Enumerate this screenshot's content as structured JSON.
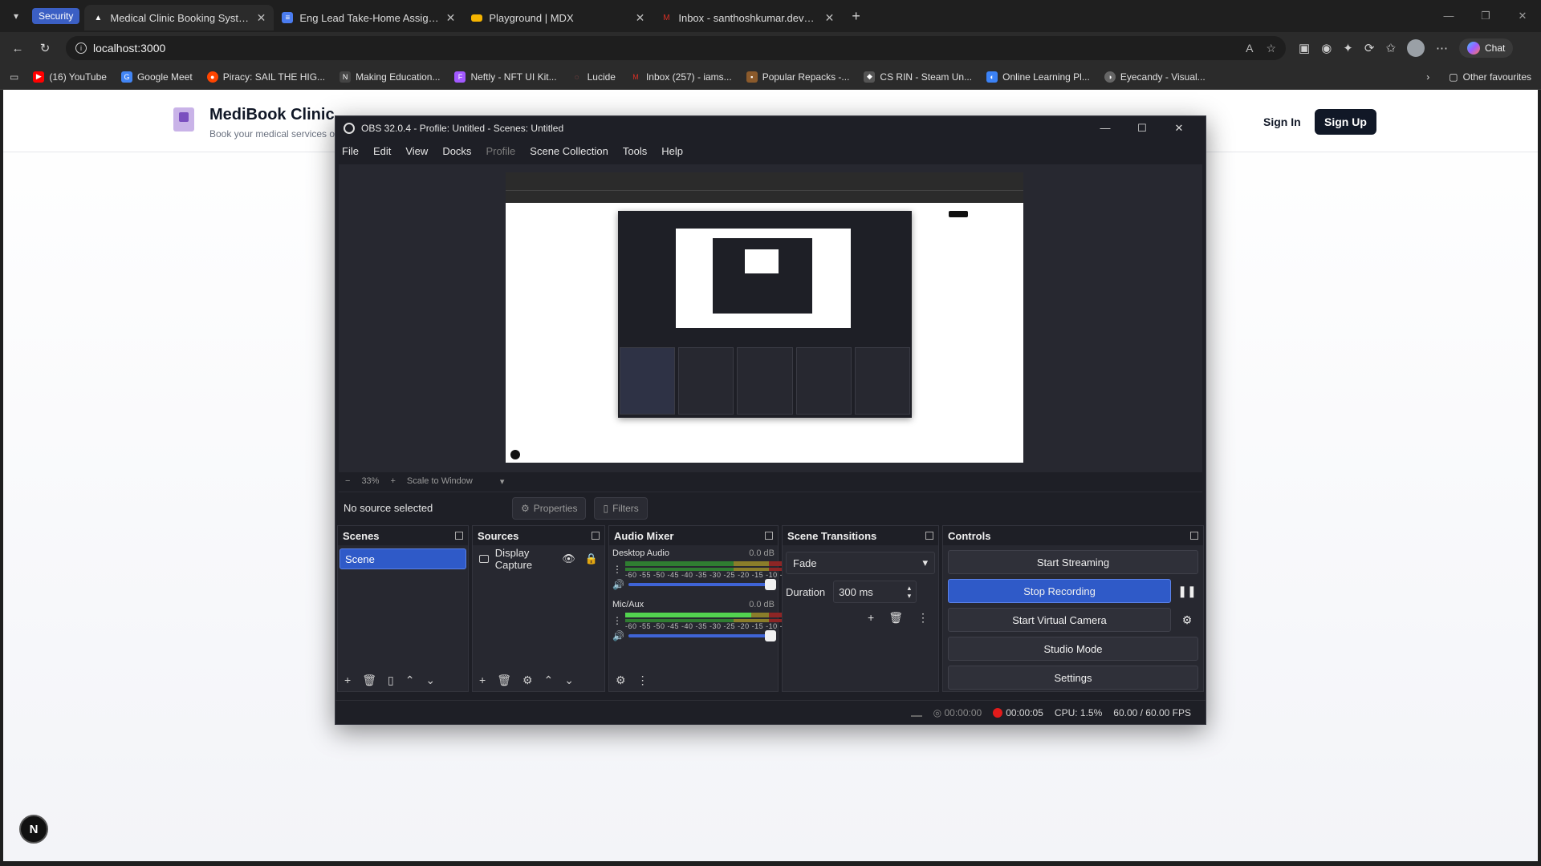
{
  "browser": {
    "security_chip": "Security",
    "tabs": [
      {
        "title": "Medical Clinic Booking System",
        "active": true,
        "icon": "triangle-logo-icon"
      },
      {
        "title": "Eng Lead Take-Home Assignment",
        "active": false,
        "icon": "docs-icon"
      },
      {
        "title": "Playground | MDX",
        "active": false,
        "icon": "mdx-icon"
      },
      {
        "title": "Inbox - santhoshkumar.devmail@...",
        "active": false,
        "icon": "gmail-icon"
      }
    ],
    "url": "localhost:3000",
    "chat_label": "Chat",
    "bookmarks": [
      {
        "label": "(16) YouTube",
        "icon": "youtube-icon",
        "color": "#ff0000"
      },
      {
        "label": "Google Meet",
        "icon": "google-icon",
        "color": "#4285f4"
      },
      {
        "label": "Piracy: SAIL THE HIG...",
        "icon": "reddit-icon",
        "color": "#ff4500"
      },
      {
        "label": "Making Education...",
        "icon": "notion-icon",
        "color": "#444444"
      },
      {
        "label": "Neftly - NFT UI Kit...",
        "icon": "figma-icon",
        "color": "#a259ff"
      },
      {
        "label": "Lucide",
        "icon": "lucide-icon",
        "color": "#f56565"
      },
      {
        "label": "Inbox (257) - iams...",
        "icon": "gmail-icon",
        "color": "#d93025"
      },
      {
        "label": "Popular Repacks -...",
        "icon": "repack-icon",
        "color": "#8b5a2b"
      },
      {
        "label": "CS RIN - Steam Un...",
        "icon": "cs-rin-icon",
        "color": "#555555"
      },
      {
        "label": "Online Learning Pl...",
        "icon": "learning-icon",
        "color": "#3b82f6"
      },
      {
        "label": "Eyecandy - Visual...",
        "icon": "eyecandy-icon",
        "color": "#666666"
      }
    ],
    "other_favourites": "Other favourites"
  },
  "site": {
    "brand": "MediBook Clinic",
    "tagline": "Book your medical services o",
    "sign_in": "Sign In",
    "sign_up": "Sign Up",
    "next_badge": "N"
  },
  "obs": {
    "title": "OBS 32.0.4 - Profile: Untitled - Scenes: Untitled",
    "menu": [
      "File",
      "Edit",
      "View",
      "Docks",
      "Profile",
      "Scene Collection",
      "Tools",
      "Help"
    ],
    "zoom": "33%",
    "scale_mode": "Scale to Window",
    "no_source": "No source selected",
    "properties": "Properties",
    "filters": "Filters",
    "docks": {
      "scenes": {
        "title": "Scenes",
        "items": [
          "Scene"
        ]
      },
      "sources": {
        "title": "Sources",
        "items": [
          "Display Capture"
        ]
      },
      "mixer": {
        "title": "Audio Mixer",
        "ticks": "-60 -55 -50 -45 -40 -35 -30 -25 -20 -15 -10 -5 0",
        "channels": [
          {
            "name": "Desktop Audio",
            "db": "0.0 dB",
            "level": 0.0
          },
          {
            "name": "Mic/Aux",
            "db": "0.0 dB",
            "level": 0.72
          }
        ]
      },
      "transitions": {
        "title": "Scene Transitions",
        "selected": "Fade",
        "duration_label": "Duration",
        "duration_value": "300 ms"
      },
      "controls": {
        "title": "Controls",
        "start_streaming": "Start Streaming",
        "stop_recording": "Stop Recording",
        "start_virtual_camera": "Start Virtual Camera",
        "studio_mode": "Studio Mode",
        "settings": "Settings"
      }
    },
    "status": {
      "stream_time": "00:00:00",
      "rec_time": "00:00:05",
      "cpu": "CPU: 1.5%",
      "fps": "60.00 / 60.00 FPS"
    }
  }
}
